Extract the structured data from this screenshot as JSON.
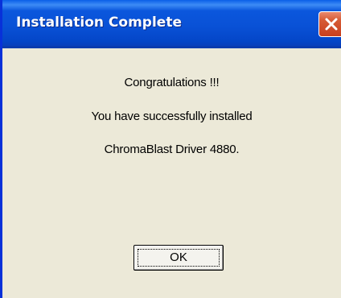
{
  "window": {
    "title": "Installation Complete",
    "close_icon": "close-icon"
  },
  "message": {
    "line1": "Congratulations !!!",
    "line2": "You have successfully installed",
    "line3": "ChromaBlast Driver 4880."
  },
  "buttons": {
    "ok_label": "OK"
  },
  "colors": {
    "titlebar": "#0951d6",
    "dialog_background": "#ece9d8",
    "close_button": "#d65a34",
    "border": "#0831d9"
  }
}
